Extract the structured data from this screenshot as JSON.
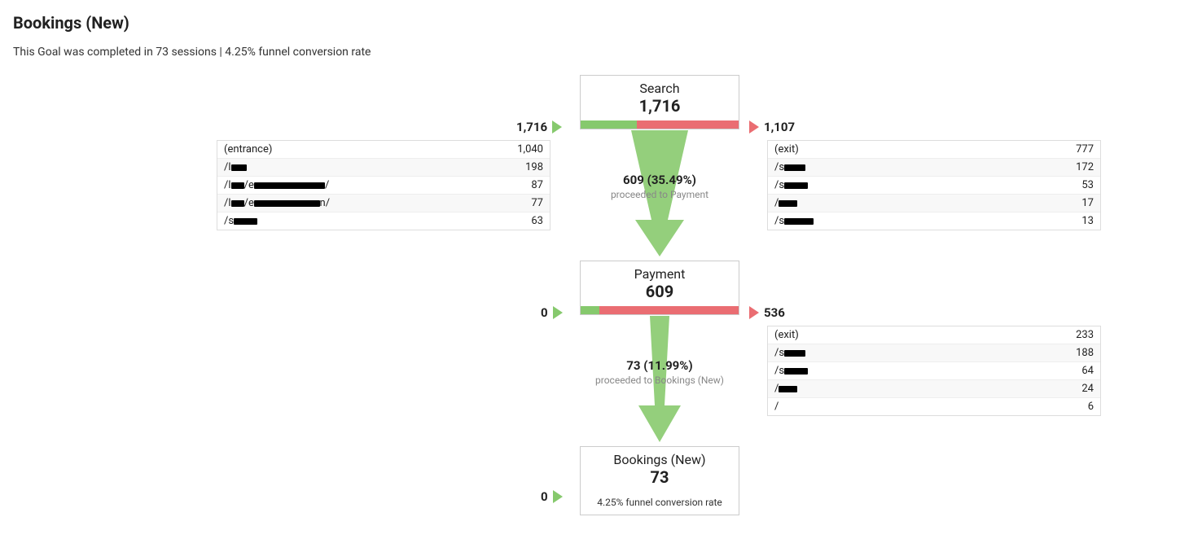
{
  "title": "Bookings (New)",
  "subtitle": "This Goal was completed in 73 sessions | 4.25% funnel conversion rate",
  "steps": [
    {
      "name": "Search",
      "value": "1,716",
      "inflow": "1,716",
      "outflow": "1,107",
      "greenPct": 35.49,
      "proceed_text": "609 (35.49%)",
      "proceed_sub": "proceeded to Payment",
      "in_rows": [
        {
          "label": "(entrance)",
          "val": "1,040"
        },
        {
          "label": "/l████████",
          "val": "198"
        },
        {
          "label": "/l███████/e██████████████████████████████████/",
          "val": "87"
        },
        {
          "label": "/l███████/e████████████████████████████████n/",
          "val": "77"
        },
        {
          "label": "/s████████████",
          "val": "63"
        }
      ],
      "out_rows": [
        {
          "label": "(exit)",
          "val": "777"
        },
        {
          "label": "/s███████████",
          "val": "172"
        },
        {
          "label": "/s████████████",
          "val": "53"
        },
        {
          "label": "/█████████",
          "val": "17"
        },
        {
          "label": "/s██████████████",
          "val": "13"
        }
      ]
    },
    {
      "name": "Payment",
      "value": "609",
      "inflow": "0",
      "outflow": "536",
      "greenPct": 11.99,
      "proceed_text": "73 (11.99%)",
      "proceed_sub": "proceeded to Bookings (New)",
      "in_rows": [],
      "out_rows": [
        {
          "label": "(exit)",
          "val": "233"
        },
        {
          "label": "/s███████████",
          "val": "188"
        },
        {
          "label": "/s████████████",
          "val": "64"
        },
        {
          "label": "/█████████",
          "val": "24"
        },
        {
          "label": "/",
          "val": "6"
        }
      ]
    },
    {
      "name": "Bookings (New)",
      "value": "73",
      "inflow": "0",
      "outflow": "",
      "extra": "4.25% funnel conversion rate"
    }
  ],
  "chart_data": {
    "type": "funnel",
    "title": "Bookings (New)",
    "conversion_rate": 4.25,
    "completed_sessions": 73,
    "steps": [
      {
        "name": "Search",
        "count": 1716,
        "entering": 1716,
        "exiting": 1107,
        "proceeding": 609,
        "proceed_rate": 35.49,
        "top_entrances": [
          {
            "path": "(entrance)",
            "count": 1040
          },
          {
            "path": "[redacted-path-1]",
            "count": 198
          },
          {
            "path": "[redacted-path-2]",
            "count": 87
          },
          {
            "path": "[redacted-path-3]",
            "count": 77
          },
          {
            "path": "[redacted-path-4]",
            "count": 63
          }
        ],
        "top_exits": [
          {
            "path": "(exit)",
            "count": 777
          },
          {
            "path": "[redacted-path-5]",
            "count": 172
          },
          {
            "path": "[redacted-path-6]",
            "count": 53
          },
          {
            "path": "[redacted-path-7]",
            "count": 17
          },
          {
            "path": "[redacted-path-8]",
            "count": 13
          }
        ]
      },
      {
        "name": "Payment",
        "count": 609,
        "entering": 0,
        "exiting": 536,
        "proceeding": 73,
        "proceed_rate": 11.99,
        "top_entrances": [],
        "top_exits": [
          {
            "path": "(exit)",
            "count": 233
          },
          {
            "path": "[redacted-path-9]",
            "count": 188
          },
          {
            "path": "[redacted-path-10]",
            "count": 64
          },
          {
            "path": "[redacted-path-11]",
            "count": 24
          },
          {
            "path": "/",
            "count": 6
          }
        ]
      },
      {
        "name": "Bookings (New)",
        "count": 73,
        "funnel_conversion_rate": 4.25
      }
    ]
  }
}
